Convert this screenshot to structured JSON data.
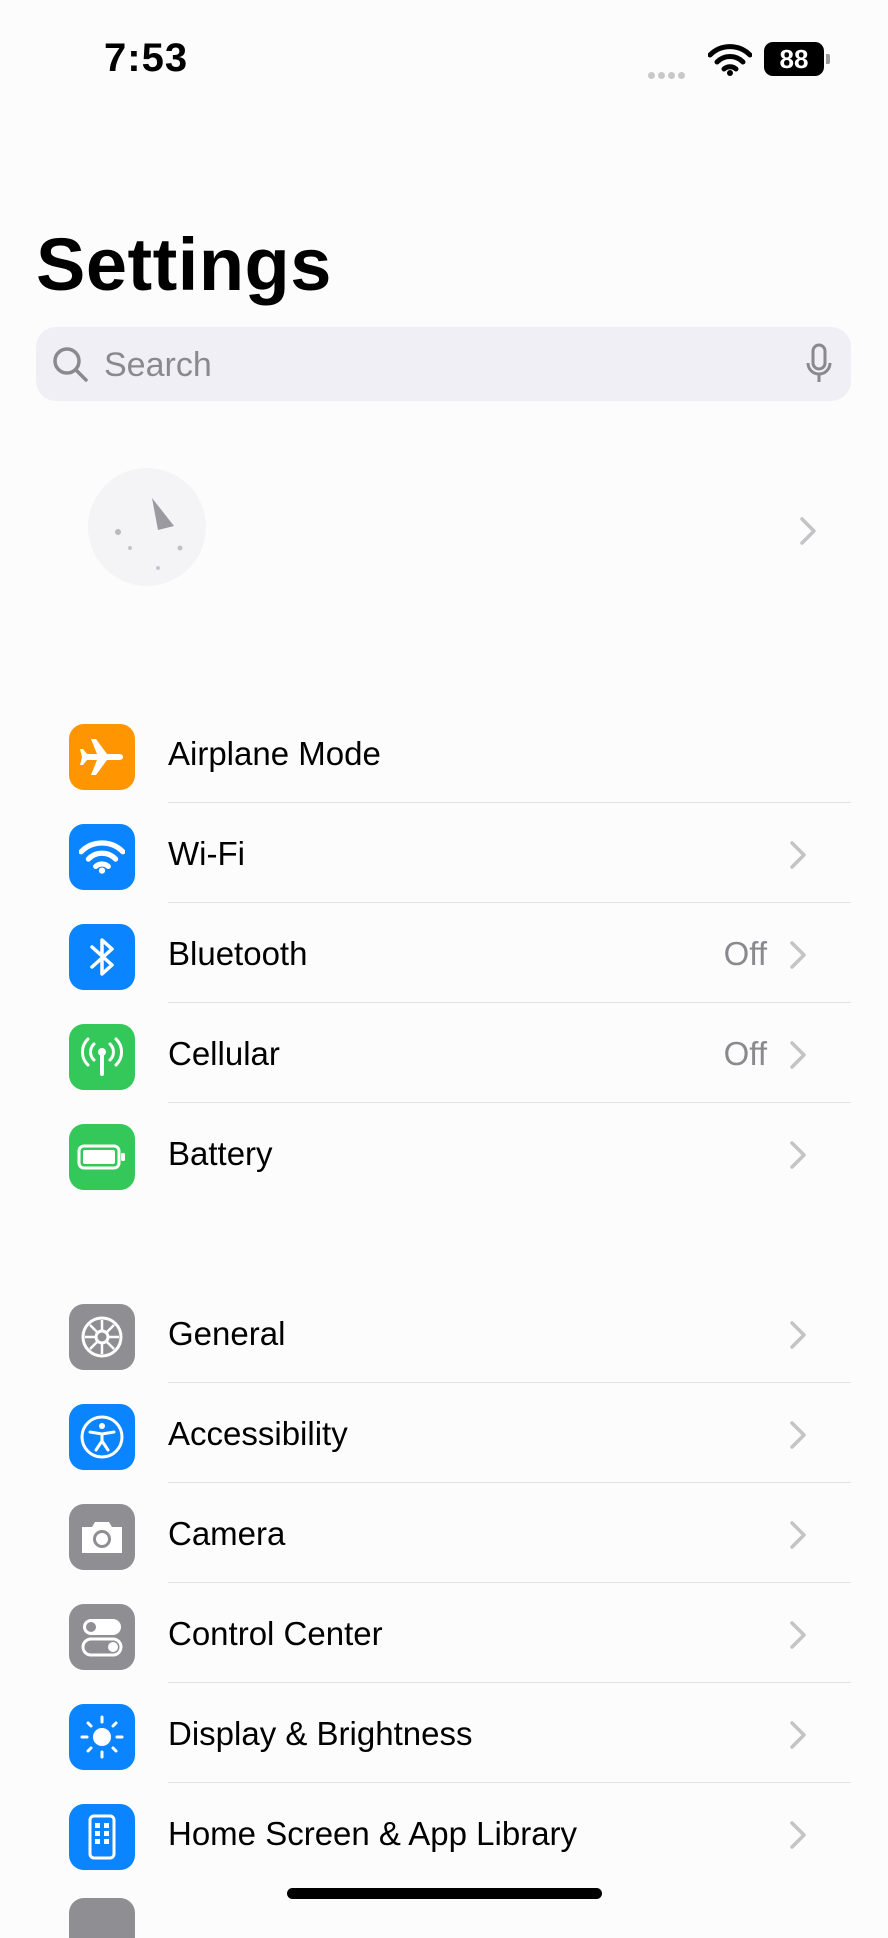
{
  "status_bar": {
    "time": "7:53",
    "battery_level": "88"
  },
  "header": {
    "title": "Settings"
  },
  "search": {
    "placeholder": "Search"
  },
  "connectivity": [
    {
      "label": "Airplane Mode",
      "value": "",
      "icon": "airplane-icon",
      "color": "#ff9500"
    },
    {
      "label": "Wi-Fi",
      "value": "",
      "icon": "wifi-icon",
      "color": "#0a84ff"
    },
    {
      "label": "Bluetooth",
      "value": "Off",
      "icon": "bluetooth-icon",
      "color": "#0a84ff"
    },
    {
      "label": "Cellular",
      "value": "Off",
      "icon": "antenna-icon",
      "color": "#34c759"
    },
    {
      "label": "Battery",
      "value": "",
      "icon": "battery-icon",
      "color": "#34c759"
    }
  ],
  "system": [
    {
      "label": "General",
      "icon": "gear-icon",
      "color": "#8e8e93"
    },
    {
      "label": "Accessibility",
      "icon": "accessibility-icon",
      "color": "#0a84ff"
    },
    {
      "label": "Camera",
      "icon": "camera-icon",
      "color": "#8e8e93"
    },
    {
      "label": "Control Center",
      "icon": "toggles-icon",
      "color": "#8e8e93"
    },
    {
      "label": "Display & Brightness",
      "icon": "sun-icon",
      "color": "#0a84ff"
    },
    {
      "label": "Home Screen & App Library",
      "icon": "home-screen-icon",
      "color": "#0a84ff"
    }
  ]
}
